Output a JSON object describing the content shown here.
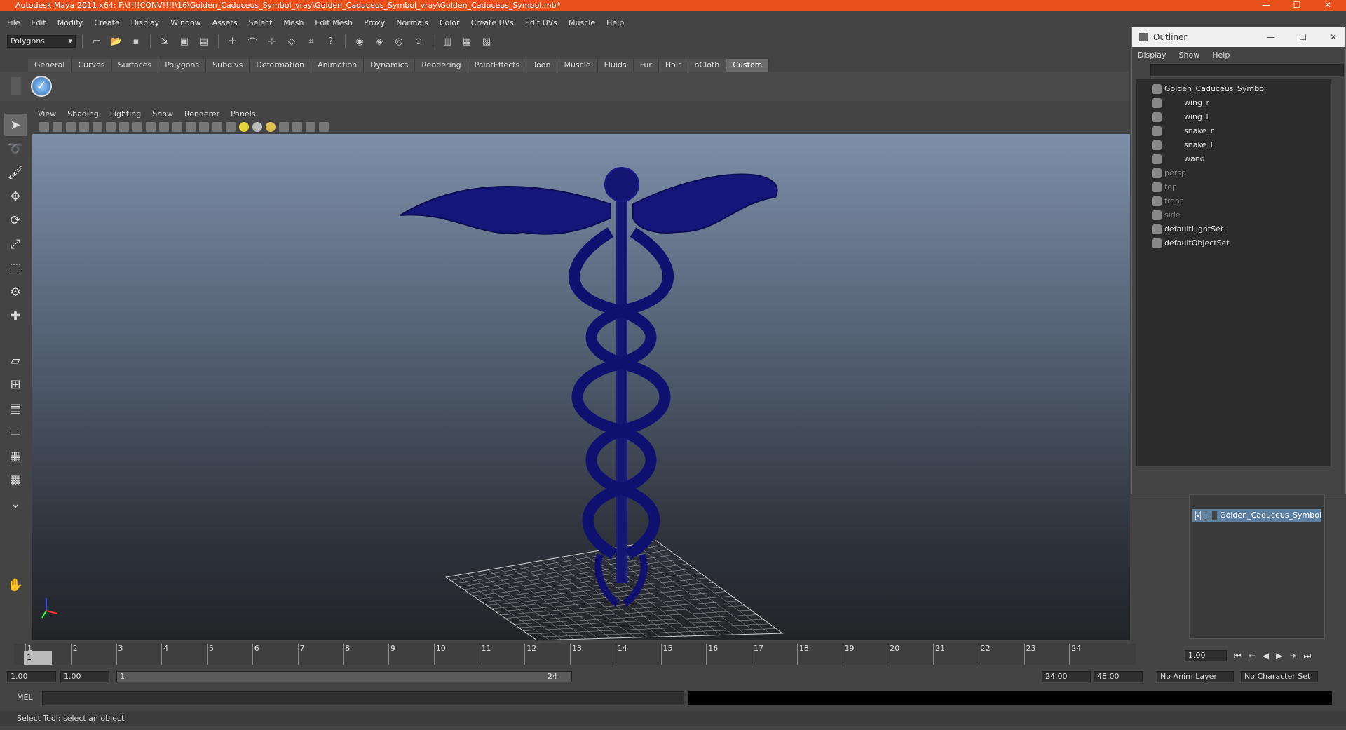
{
  "titlebar": {
    "title": "Autodesk Maya 2011 x64: F:\\!!!!CONV!!!!\\16\\Golden_Caduceus_Symbol_vray\\Golden_Caduceus_Symbol_vray\\Golden_Caduceus_Symbol.mb*",
    "minimize": "—",
    "maximize": "☐",
    "close": "✕"
  },
  "menubar": [
    "File",
    "Edit",
    "Modify",
    "Create",
    "Display",
    "Window",
    "Assets",
    "Select",
    "Mesh",
    "Edit Mesh",
    "Proxy",
    "Normals",
    "Color",
    "Create UVs",
    "Edit UVs",
    "Muscle",
    "Help"
  ],
  "statusline": {
    "mode": "Polygons"
  },
  "shelf": {
    "tabs": [
      "General",
      "Curves",
      "Surfaces",
      "Polygons",
      "Subdivs",
      "Deformation",
      "Animation",
      "Dynamics",
      "Rendering",
      "PaintEffects",
      "Toon",
      "Muscle",
      "Fluids",
      "Fur",
      "Hair",
      "nCloth",
      "Custom"
    ],
    "active": "Custom"
  },
  "viewport": {
    "menu": [
      "View",
      "Shading",
      "Lighting",
      "Show",
      "Renderer",
      "Panels"
    ]
  },
  "outliner": {
    "title": "Outliner",
    "menu": [
      "Display",
      "Show",
      "Help"
    ],
    "items": [
      {
        "label": "Golden_Caduceus_Symbol",
        "dim": false,
        "indent": 0
      },
      {
        "label": "wing_r",
        "dim": false,
        "indent": 1
      },
      {
        "label": "wing_l",
        "dim": false,
        "indent": 1
      },
      {
        "label": "snake_r",
        "dim": false,
        "indent": 1
      },
      {
        "label": "snake_l",
        "dim": false,
        "indent": 1
      },
      {
        "label": "wand",
        "dim": false,
        "indent": 1
      },
      {
        "label": "persp",
        "dim": true,
        "indent": 0
      },
      {
        "label": "top",
        "dim": true,
        "indent": 0
      },
      {
        "label": "front",
        "dim": true,
        "indent": 0
      },
      {
        "label": "side",
        "dim": true,
        "indent": 0
      },
      {
        "label": "defaultLightSet",
        "dim": false,
        "indent": 0
      },
      {
        "label": "defaultObjectSet",
        "dim": false,
        "indent": 0
      }
    ]
  },
  "layers": {
    "visible": "V",
    "name": "Golden_Caduceus_Symbol"
  },
  "timeline": {
    "ticks": [
      "1",
      "2",
      "3",
      "4",
      "5",
      "6",
      "7",
      "8",
      "9",
      "10",
      "11",
      "12",
      "13",
      "14",
      "15",
      "16",
      "17",
      "18",
      "19",
      "20",
      "21",
      "22",
      "23",
      "24"
    ],
    "current_frame": "1.00",
    "current_marker": "1"
  },
  "range": {
    "start": "1.00",
    "anim_start": "1.00",
    "range_start": "1",
    "range_end": "24",
    "anim_end": "24.00",
    "end": "48.00",
    "anim_layer": "No Anim Layer",
    "char_set": "No Character Set"
  },
  "mel": {
    "label": "MEL"
  },
  "status": {
    "text": "Select Tool: select an object"
  }
}
